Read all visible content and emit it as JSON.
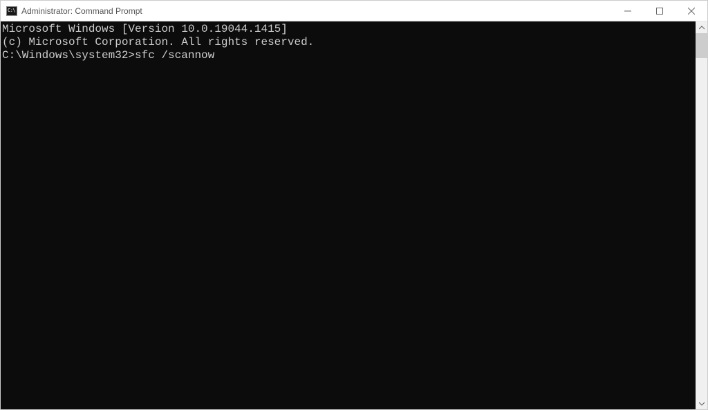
{
  "window": {
    "title": "Administrator: Command Prompt"
  },
  "terminal": {
    "line1": "Microsoft Windows [Version 10.0.19044.1415]",
    "line2": "(c) Microsoft Corporation. All rights reserved.",
    "blank1": "",
    "prompt": "C:\\Windows\\system32>",
    "command": "sfc /scannow"
  }
}
